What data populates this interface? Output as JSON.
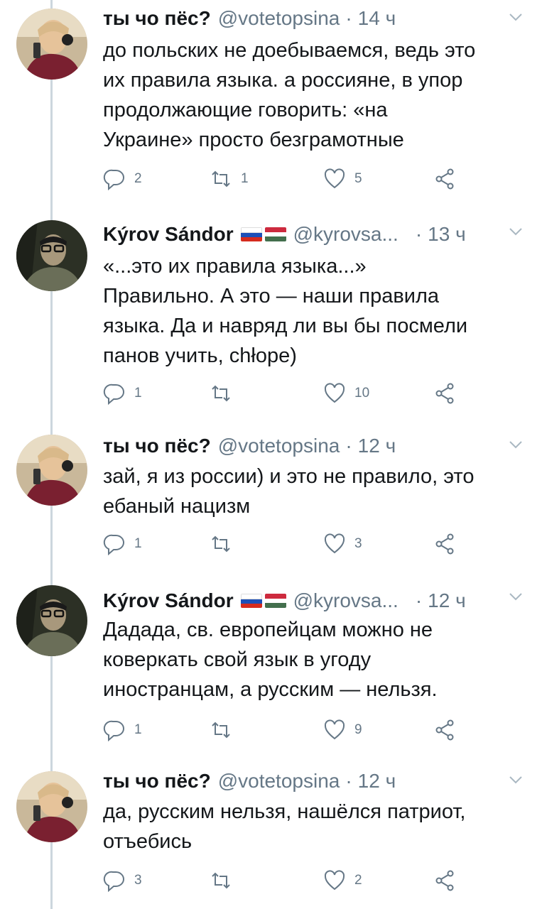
{
  "tweets": [
    {
      "name": "ты чо пёс?",
      "handle": "@votetopsina",
      "sep": "·",
      "time": "14 ч",
      "text": "до польских не доебываемся, ведь это\nих правила языка. а россияне, в упор\nпродолжающие говорить: «на\nУкраине» просто безграмотные",
      "replies": "2",
      "retweets": "1",
      "likes": "5",
      "has_flags": false
    },
    {
      "name": "Kýrov Sándor",
      "handle": "@kyrovsa...",
      "sep": "·",
      "time": "13 ч",
      "text": "«...это их правила языка...»\nПравильно. А это — наши правила\nязыка. Да и навряд ли вы бы посмели\nпанов учить, chłope)",
      "replies": "1",
      "retweets": "",
      "likes": "10",
      "has_flags": true
    },
    {
      "name": "ты чо пёс?",
      "handle": "@votetopsina",
      "sep": "·",
      "time": "12 ч",
      "text": "зай, я из россии) и это не правило, это\nебаный нацизм",
      "replies": "1",
      "retweets": "",
      "likes": "3",
      "has_flags": false
    },
    {
      "name": "Kýrov Sándor",
      "handle": "@kyrovsa...",
      "sep": "·",
      "time": "12 ч",
      "text": "Дадада, св. европейцам можно не\nковеркать свой язык в угоду\nиностранцам, а русским — нельзя.",
      "replies": "1",
      "retweets": "",
      "likes": "9",
      "has_flags": true
    },
    {
      "name": "ты чо пёс?",
      "handle": "@votetopsina",
      "sep": "·",
      "time": "12 ч",
      "text": "да, русским нельзя, нашёлся патриот,\nотъебись",
      "replies": "3",
      "retweets": "",
      "likes": "2",
      "has_flags": false
    }
  ],
  "icons": {
    "reply": "reply-icon",
    "retweet": "retweet-icon",
    "like": "heart-icon",
    "share": "share-icon",
    "caret": "chevron-down-icon"
  },
  "colors": {
    "text": "#14171a",
    "secondary": "#657786",
    "thread_line": "#ccd6dd"
  }
}
